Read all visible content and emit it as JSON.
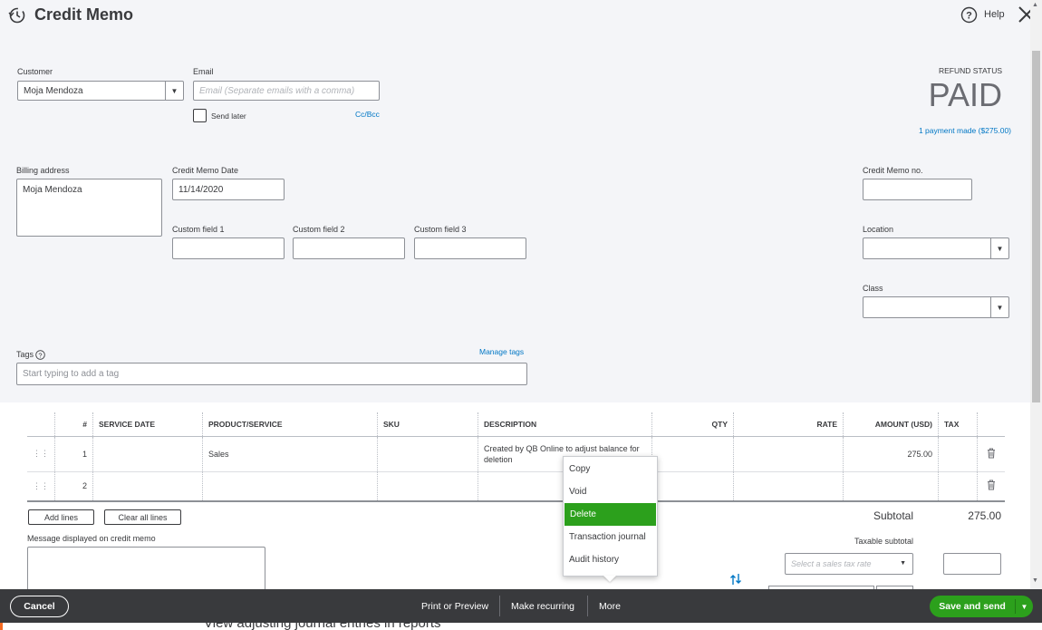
{
  "header": {
    "title": "Credit Memo",
    "help_label": "Help"
  },
  "customer": {
    "label": "Customer",
    "value": "Moja Mendoza"
  },
  "email": {
    "label": "Email",
    "placeholder": "Email (Separate emails with a comma)",
    "send_later_label": "Send later",
    "cc_bcc_label": "Cc/Bcc"
  },
  "refund": {
    "label": "REFUND STATUS",
    "status": "PAID",
    "payment_link": "1 payment made ($275.00)"
  },
  "billing": {
    "label": "Billing address",
    "value": "Moja Mendoza"
  },
  "date": {
    "label": "Credit Memo Date",
    "value": "11/14/2020"
  },
  "custom_fields": [
    {
      "label": "Custom field 1",
      "value": ""
    },
    {
      "label": "Custom field 2",
      "value": ""
    },
    {
      "label": "Custom field 3",
      "value": ""
    }
  ],
  "memo_no": {
    "label": "Credit Memo no.",
    "value": ""
  },
  "location": {
    "label": "Location",
    "value": ""
  },
  "class_field": {
    "label": "Class",
    "value": ""
  },
  "tags": {
    "label": "Tags",
    "placeholder": "Start typing to add a tag",
    "manage_label": "Manage tags"
  },
  "table": {
    "columns": [
      "#",
      "SERVICE DATE",
      "PRODUCT/SERVICE",
      "SKU",
      "DESCRIPTION",
      "QTY",
      "RATE",
      "AMOUNT (USD)",
      "TAX"
    ],
    "rows": [
      {
        "num": "1",
        "service_date": "",
        "product": "Sales",
        "sku": "",
        "description": "Created by QB Online to adjust balance for deletion",
        "qty": "",
        "rate": "",
        "amount": "275.00",
        "tax": ""
      },
      {
        "num": "2",
        "service_date": "",
        "product": "",
        "sku": "",
        "description": "",
        "qty": "",
        "rate": "",
        "amount": "",
        "tax": ""
      }
    ]
  },
  "actions": {
    "add_lines": "Add lines",
    "clear_all": "Clear all lines"
  },
  "message": {
    "label": "Message displayed on credit memo"
  },
  "totals": {
    "subtotal_label": "Subtotal",
    "subtotal_value": "275.00",
    "taxable_label": "Taxable subtotal",
    "tax_rate_placeholder": "Select a sales tax rate"
  },
  "context_menu": {
    "items": [
      "Copy",
      "Void",
      "Delete",
      "Transaction journal",
      "Audit history"
    ],
    "active": "Delete"
  },
  "footer": {
    "cancel": "Cancel",
    "print_preview": "Print or Preview",
    "make_recurring": "Make recurring",
    "more": "More",
    "save_send": "Save and send"
  },
  "behind_text": "View adjusting journal entries in reports",
  "colors": {
    "green": "#2ca01c",
    "footer_bg": "#393a3d",
    "link": "#0077c5",
    "panel_bg": "#f4f5f8"
  }
}
